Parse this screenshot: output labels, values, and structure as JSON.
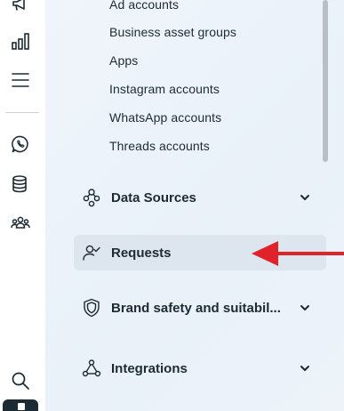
{
  "colors": {
    "text": "#1c2b33",
    "panel_bg": "#ecf3fa",
    "active_bg": "#dde5ee",
    "annotation_arrow": "#e0222a"
  },
  "rail": {
    "icons": [
      "megaphone-icon",
      "bar-chart-icon",
      "menu-icon",
      "whatsapp-icon",
      "database-icon",
      "people-group-icon",
      "search-icon"
    ]
  },
  "sub_items": [
    {
      "label": "Ad accounts"
    },
    {
      "label": "Business asset groups"
    },
    {
      "label": "Apps"
    },
    {
      "label": "Instagram accounts"
    },
    {
      "label": "WhatsApp accounts"
    },
    {
      "label": "Threads accounts"
    }
  ],
  "sections": [
    {
      "label": "Data Sources",
      "icon": "data-sources-icon",
      "chevron": true
    },
    {
      "label": "Requests",
      "icon": "person-check-icon",
      "chevron": false,
      "active": true
    },
    {
      "label": "Brand safety and suitabil...",
      "icon": "shield-icon",
      "chevron": true
    },
    {
      "label": "Integrations",
      "icon": "integrations-icon",
      "chevron": true
    }
  ]
}
